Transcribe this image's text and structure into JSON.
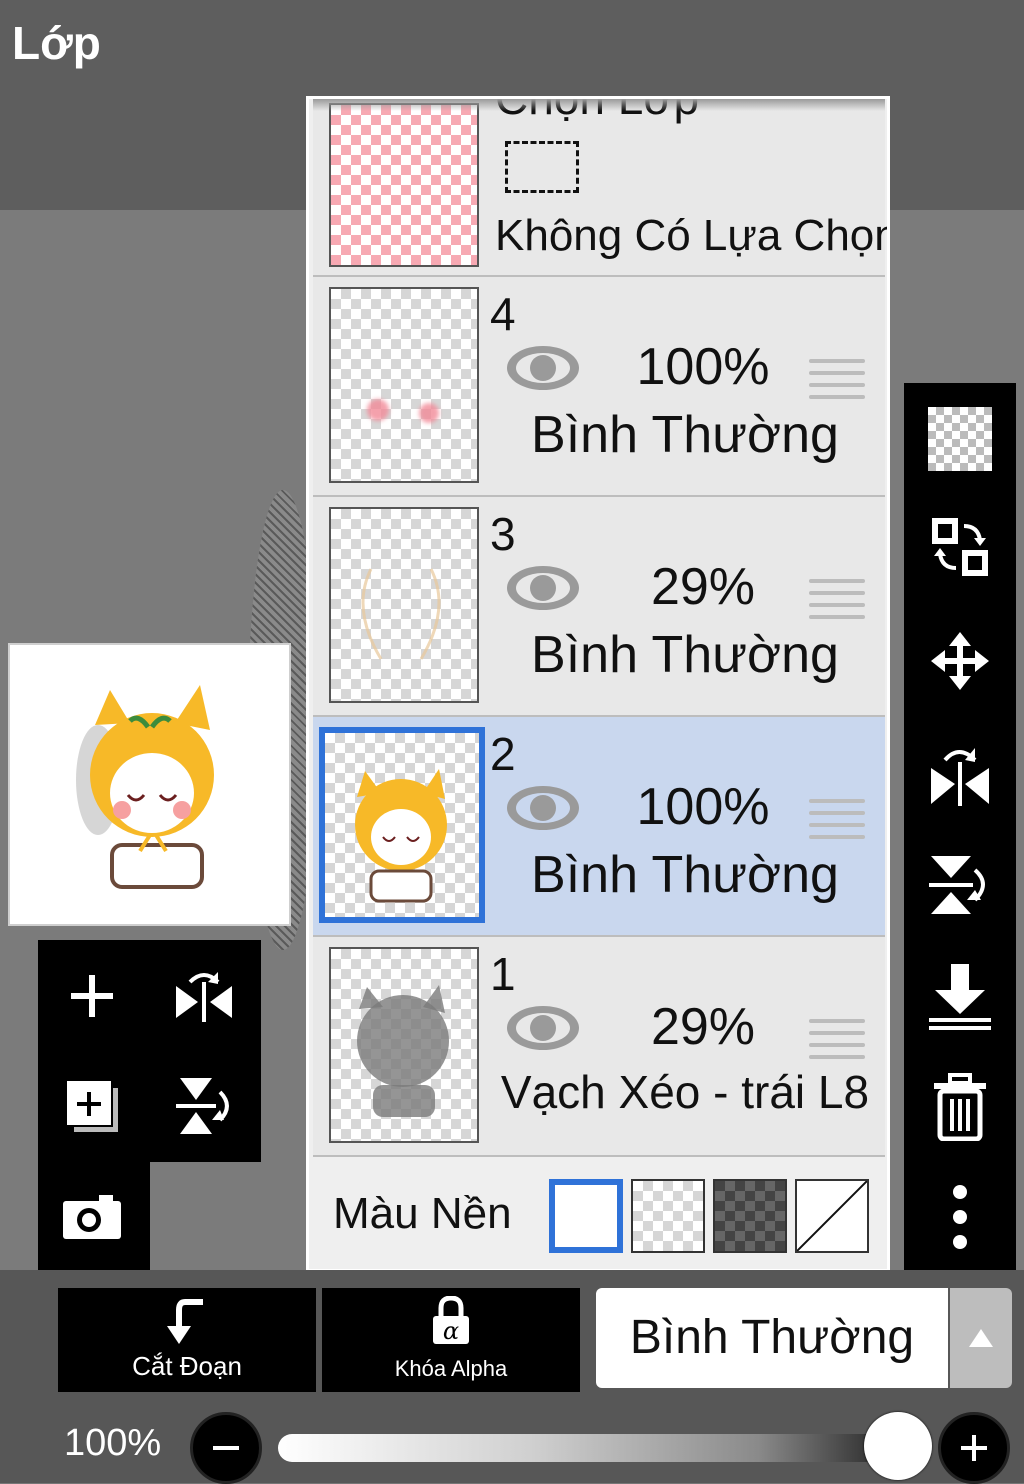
{
  "header": {
    "title": "Lớp"
  },
  "selection_row": {
    "title": "Chọn Lớp",
    "status": "Không Có Lựa Chọn"
  },
  "layers": [
    {
      "number": "4",
      "opacity": "100%",
      "blend": "Bình Thường",
      "selected": false
    },
    {
      "number": "3",
      "opacity": "29%",
      "blend": "Bình Thường",
      "selected": false
    },
    {
      "number": "2",
      "opacity": "100%",
      "blend": "Bình Thường",
      "selected": true
    },
    {
      "number": "1",
      "opacity": "29%",
      "blend": "Vạch Xéo - trái L8",
      "selected": false
    }
  ],
  "background": {
    "label": "Màu Nền",
    "selected_option": "white"
  },
  "bottom": {
    "clip_label": "Cắt Đoạn",
    "alpha_lock_label": "Khóa Alpha",
    "blend_mode": "Bình Thường",
    "zoom": "100%"
  },
  "icons": {
    "left": [
      "plus-icon",
      "flip-horizontal-icon",
      "add-layer-icon",
      "flip-vertical-icon",
      "camera-icon"
    ],
    "right": [
      "transparency-icon",
      "swap-icon",
      "move-icon",
      "flip-horizontal-icon",
      "flip-vertical-icon",
      "merge-down-icon",
      "trash-icon",
      "more-icon"
    ]
  },
  "colors": {
    "accent": "#2f72d8",
    "selected_row": "#c9d7ee",
    "toolbar": "#000000"
  }
}
